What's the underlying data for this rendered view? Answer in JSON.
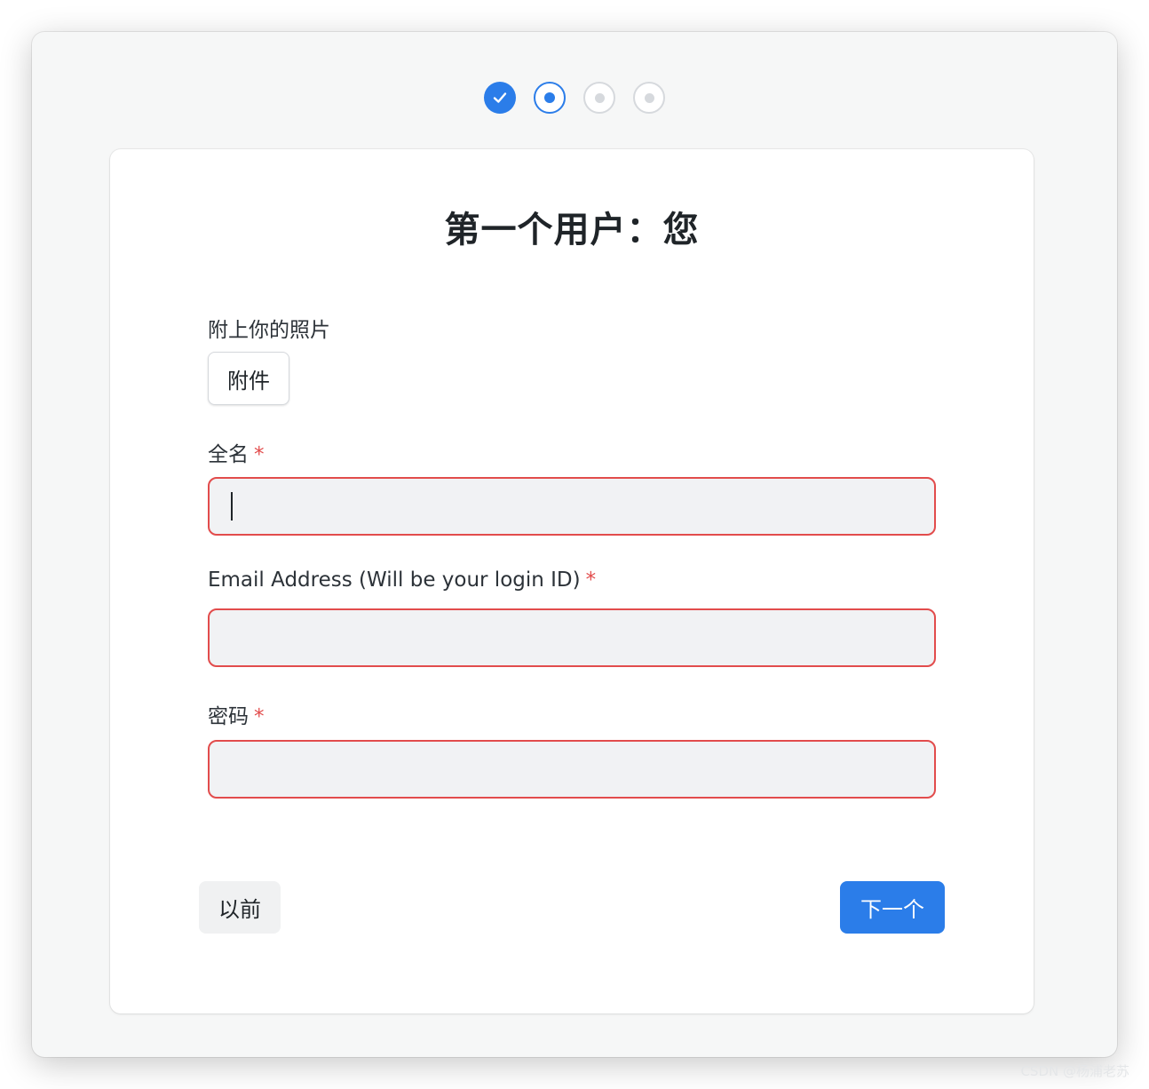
{
  "steps": {
    "icons": [
      "check-icon",
      "active-dot-icon",
      "dot-icon",
      "dot-icon"
    ],
    "states": [
      "done",
      "active",
      "pending",
      "pending"
    ]
  },
  "form": {
    "title": "第一个用户：您",
    "photo_label": "附上你的照片",
    "attach_button": "附件",
    "full_name_label": "全名",
    "full_name_value": "",
    "email_label": "Email Address (Will be your login ID)",
    "email_value": "",
    "password_label": "密码",
    "password_value": "",
    "required_mark": "*"
  },
  "actions": {
    "previous": "以前",
    "next": "下一个"
  },
  "colors": {
    "accent": "#2b7de9",
    "error": "#e24c4c",
    "window_bg": "#f6f7f7",
    "field_bg": "#f1f2f4"
  },
  "watermark": "CSDN @杨浦老苏"
}
